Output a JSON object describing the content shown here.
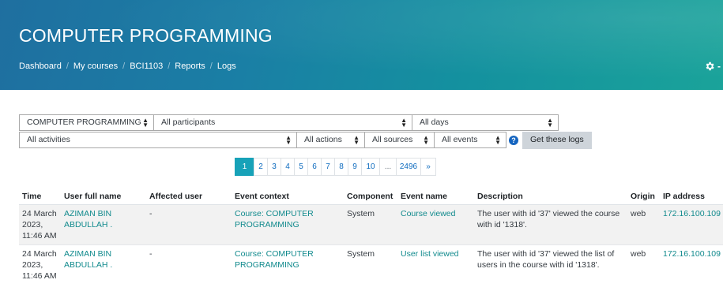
{
  "header": {
    "title": "COMPUTER PROGRAMMING",
    "breadcrumb": [
      "Dashboard",
      "My courses",
      "BCI1103",
      "Reports",
      "Logs"
    ],
    "gear_suffix": "-"
  },
  "filters": {
    "course": "COMPUTER PROGRAMMING",
    "participants": "All participants",
    "days": "All days",
    "activities": "All activities",
    "actions": "All actions",
    "sources": "All sources",
    "events": "All events",
    "submit": "Get these logs",
    "help": "?"
  },
  "pagination": {
    "pages": [
      "1",
      "2",
      "3",
      "4",
      "5",
      "6",
      "7",
      "8",
      "9",
      "10",
      "...",
      "2496",
      "»"
    ],
    "active": "1"
  },
  "table": {
    "columns": [
      "Time",
      "User full name",
      "Affected user",
      "Event context",
      "Component",
      "Event name",
      "Description",
      "Origin",
      "IP address"
    ],
    "rows": [
      {
        "time": [
          "24 March",
          "2023,",
          "11:46 AM"
        ],
        "user": [
          "AZIMAN BIN",
          "ABDULLAH ."
        ],
        "affected": "-",
        "context": [
          "Course: COMPUTER",
          "PROGRAMMING"
        ],
        "component": "System",
        "event": "Course viewed",
        "description": [
          "The user with id '37' viewed the course",
          "with id '1318'."
        ],
        "origin": "web",
        "ip": "172.16.100.109"
      },
      {
        "time": [
          "24 March",
          "2023,",
          "11:46 AM"
        ],
        "user": [
          "AZIMAN BIN",
          "ABDULLAH ."
        ],
        "affected": "-",
        "context": [
          "Course: COMPUTER",
          "PROGRAMMING"
        ],
        "component": "System",
        "event": "User list viewed",
        "description": [
          "The user with id '37' viewed the list of",
          "users in the course with id '1318'."
        ],
        "origin": "web",
        "ip": "172.16.100.109"
      }
    ]
  }
}
